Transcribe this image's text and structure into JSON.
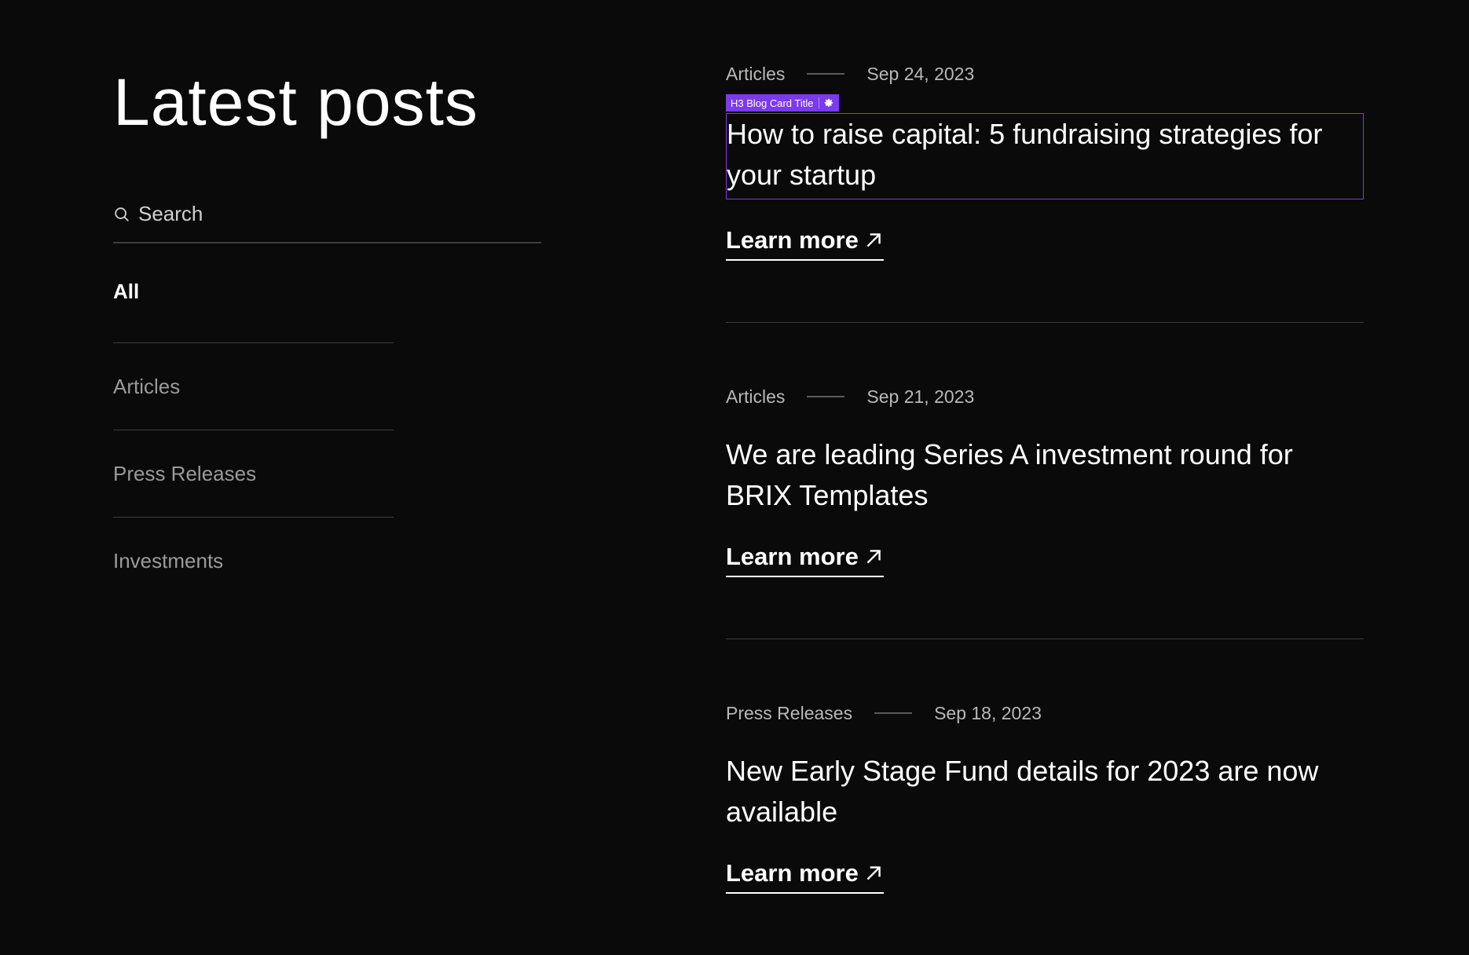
{
  "header": {
    "title": "Latest posts"
  },
  "search": {
    "placeholder": "Search"
  },
  "filters": [
    {
      "label": "All",
      "active": true
    },
    {
      "label": "Articles",
      "active": false
    },
    {
      "label": "Press Releases",
      "active": false
    },
    {
      "label": "Investments",
      "active": false
    }
  ],
  "posts": [
    {
      "category": "Articles",
      "date": "Sep 24, 2023",
      "title": "How to raise capital: 5 fundraising strategies for your startup",
      "link_label": "Learn more"
    },
    {
      "category": "Articles",
      "date": "Sep 21, 2023",
      "title": "We are leading Series A investment round for BRIX Templates",
      "link_label": "Learn more"
    },
    {
      "category": "Press Releases",
      "date": "Sep 18, 2023",
      "title": "New Early Stage Fund details for 2023 are now available",
      "link_label": "Learn more"
    }
  ],
  "editor_overlay": {
    "tag_label": "H3 Blog Card Title",
    "icon": "gear-icon",
    "accent_color": "#7c3aed"
  },
  "colors": {
    "background": "#0a0a0a",
    "text": "#ffffff",
    "muted": "#9a9a9a",
    "divider": "#3d3d3d"
  }
}
